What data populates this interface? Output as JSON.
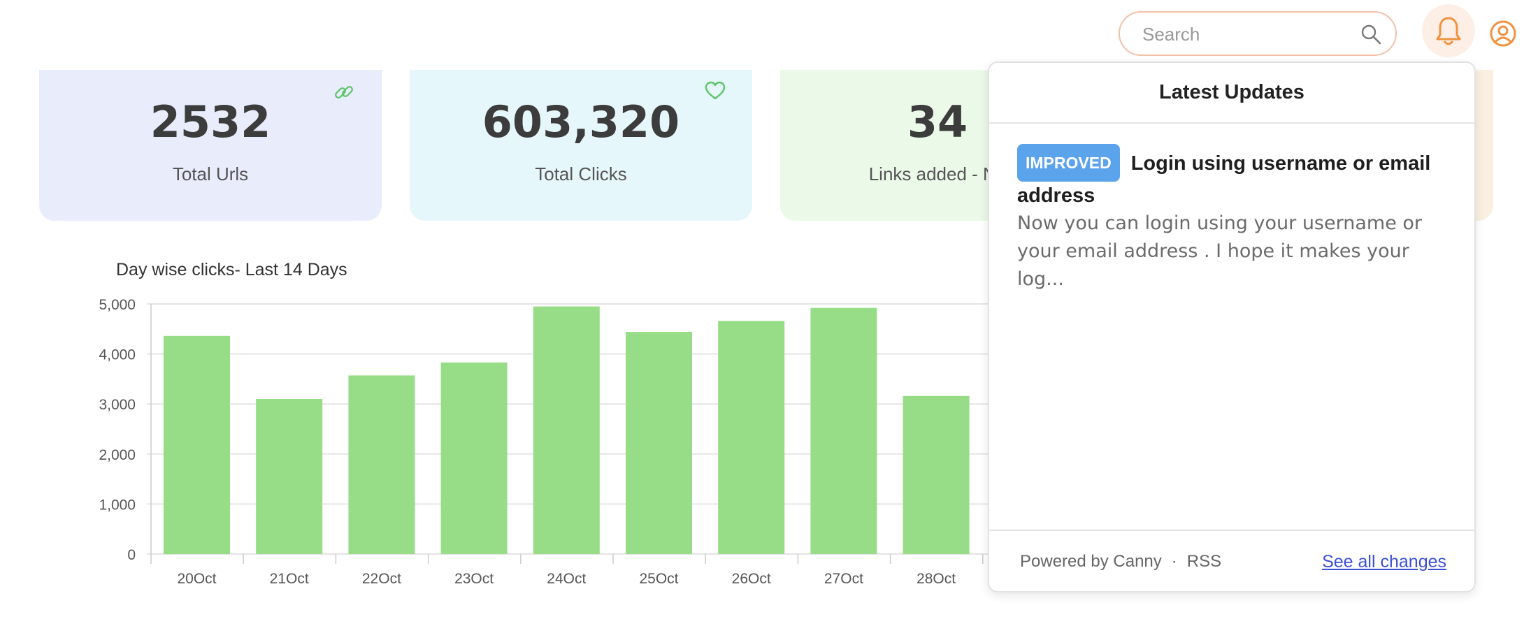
{
  "header": {
    "search_placeholder": "Search",
    "icons": [
      "search-icon",
      "bell-icon",
      "user-circle-icon"
    ],
    "accent_color": "#f0a060"
  },
  "stats": [
    {
      "value": "2532",
      "label": "Total Urls",
      "icon": "link-icon"
    },
    {
      "value": "603,320",
      "label": "Total Clicks",
      "icon": "heart-icon"
    },
    {
      "value": "34",
      "label": "Links added - No",
      "icon": ""
    }
  ],
  "chart_title": "Day wise clicks- Last 14 Days",
  "chart_data": {
    "type": "bar",
    "categories": [
      "20Oct",
      "21Oct",
      "22Oct",
      "23Oct",
      "24Oct",
      "25Oct",
      "26Oct",
      "27Oct",
      "28Oct"
    ],
    "values": [
      4360,
      3100,
      3570,
      3830,
      4950,
      4440,
      4660,
      4920,
      3160
    ],
    "ylim": [
      0,
      5000
    ],
    "yticks": [
      "0",
      "1,000",
      "2,000",
      "3,000",
      "4,000",
      "5,000"
    ],
    "grid": true,
    "bar_color": "#97dc86"
  },
  "popover": {
    "title": "Latest Updates",
    "entry": {
      "badge": "IMPROVED",
      "title": "Login using username or email address",
      "body": "Now you can login using your username or your email address . I hope it makes your log..."
    },
    "footer": {
      "powered": "Powered by Canny",
      "separator": "·",
      "rss": "RSS",
      "see_all": "See all changes"
    }
  }
}
